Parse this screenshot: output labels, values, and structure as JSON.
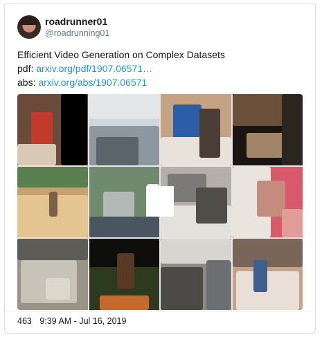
{
  "tweet": {
    "display_name": "roadrunner01",
    "handle": "@roadrunning01",
    "title": "Efficient Video Generation on Complex Datasets",
    "pdf_label": "pdf:",
    "pdf_link": "arxiv.org/pdf/1907.06571…",
    "abs_label": "abs:",
    "abs_link": "arxiv.org/abs/1907.06571",
    "like_count": "463",
    "timestamp": "9:39 AM - Jul 16, 2019"
  },
  "media": {
    "frames": [
      {
        "id": "frame-1",
        "colors": [
          "#6b4a3a",
          "#c33a2c",
          "#000000",
          "#d9c9b4"
        ]
      },
      {
        "id": "frame-2",
        "colors": [
          "#cfd6dc",
          "#8d979f",
          "#5c646b",
          "#e3e7ea"
        ]
      },
      {
        "id": "frame-3",
        "colors": [
          "#c4a385",
          "#2c5ea8",
          "#e8e2da",
          "#4a3d35"
        ]
      },
      {
        "id": "frame-4",
        "colors": [
          "#1a1512",
          "#6a4f3a",
          "#a28468",
          "#2b2520"
        ]
      },
      {
        "id": "frame-5",
        "colors": [
          "#c9a070",
          "#5a7f4e",
          "#e4c592",
          "#7a6045"
        ]
      },
      {
        "id": "frame-6",
        "colors": [
          "#6f8a6d",
          "#b3b9b6",
          "#4b5560",
          "#f2f2f2"
        ]
      },
      {
        "id": "frame-7",
        "colors": [
          "#b4b0a8",
          "#7b7a76",
          "#e3e1dc",
          "#4f4d48"
        ]
      },
      {
        "id": "frame-8",
        "colors": [
          "#d85a6a",
          "#eae4de",
          "#c38c7c",
          "#e39b98"
        ]
      },
      {
        "id": "frame-9",
        "colors": [
          "#9a9488",
          "#c7c3b8",
          "#5d5c57",
          "#ddd8ce"
        ]
      },
      {
        "id": "frame-10",
        "colors": [
          "#0e0f0c",
          "#2e3a1e",
          "#5a3826",
          "#c46a2a"
        ]
      },
      {
        "id": "frame-11",
        "colors": [
          "#8b8a86",
          "#d7d5cf",
          "#4b4a46",
          "#6c6f72"
        ]
      },
      {
        "id": "frame-12",
        "colors": [
          "#c4a28d",
          "#7a6659",
          "#e9dfd6",
          "#3f5f8c"
        ]
      }
    ]
  }
}
